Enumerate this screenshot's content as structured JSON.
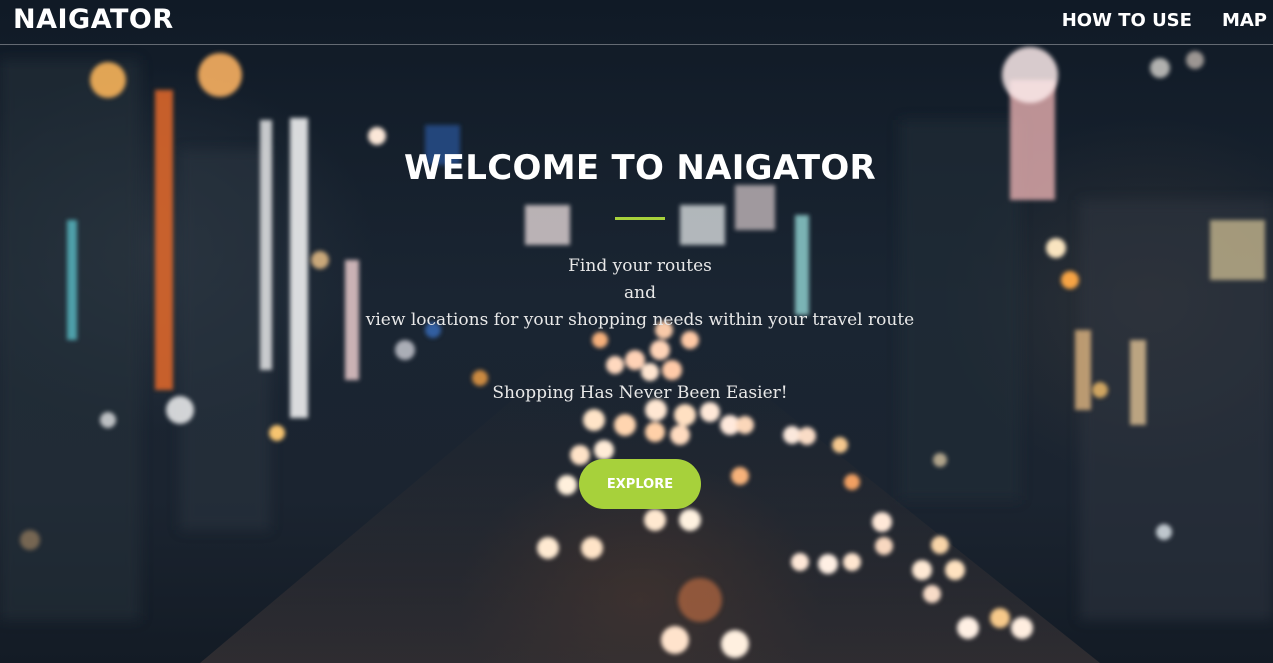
{
  "navbar": {
    "brand": "NAIGATOR",
    "links": [
      {
        "label": "HOW TO USE"
      },
      {
        "label": "MAP"
      }
    ]
  },
  "hero": {
    "title": "WELCOME TO NAIGATOR",
    "tagline_lines": [
      "Find your routes",
      "and",
      "view locations for your shopping needs within your travel route"
    ],
    "slogan": "Shopping Has Never Been Easier!",
    "cta_label": "EXPLORE"
  },
  "colors": {
    "accent": "#a7d13b",
    "text": "#ffffff",
    "background": "#16202c"
  }
}
